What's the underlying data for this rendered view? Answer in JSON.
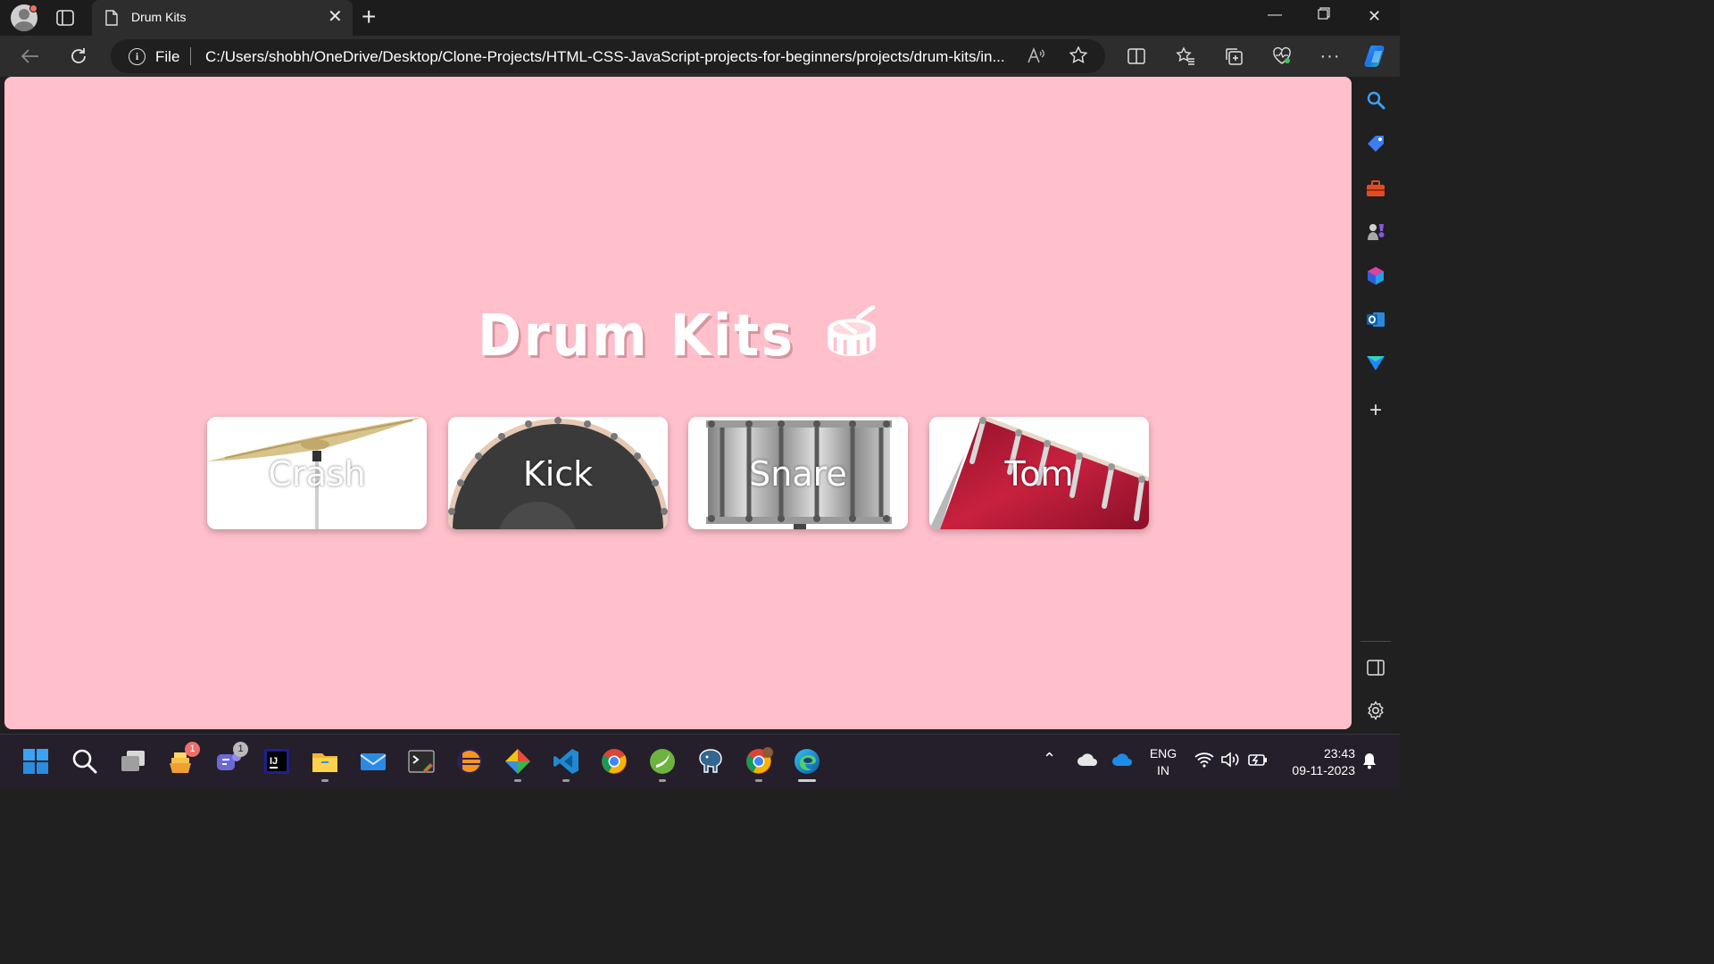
{
  "browser": {
    "tab_title": "Drum Kits",
    "address_scheme": "File",
    "address_url": "C:/Users/shobh/OneDrive/Desktop/Clone-Projects/HTML-CSS-JavaScript-projects-for-beginners/projects/drum-kits/in...",
    "read_aloud": "Â̓"
  },
  "page": {
    "heading": "Drum Kits",
    "background_color": "#ffc0cb",
    "drums": [
      {
        "label": "Crash"
      },
      {
        "label": "Kick"
      },
      {
        "label": "Snare"
      },
      {
        "label": "Tom"
      }
    ]
  },
  "taskbar": {
    "whatsnew_badge": "1",
    "teams_badge": "1",
    "language_line1": "ENG",
    "language_line2": "IN",
    "time": "23:43",
    "date": "09-11-2023"
  }
}
